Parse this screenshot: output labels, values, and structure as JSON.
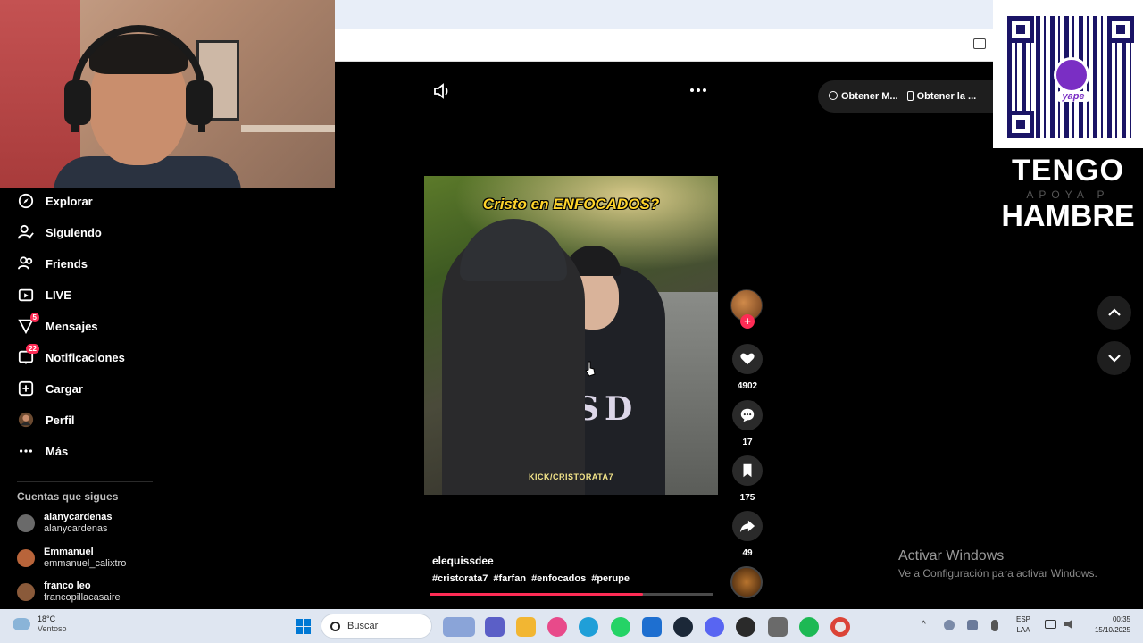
{
  "sidebar": {
    "items": [
      {
        "label": "Explorar",
        "icon": "compass-icon"
      },
      {
        "label": "Siguiendo",
        "icon": "following-icon"
      },
      {
        "label": "Friends",
        "icon": "friends-icon"
      },
      {
        "label": "LIVE",
        "icon": "live-icon"
      },
      {
        "label": "Mensajes",
        "icon": "messages-icon",
        "badge": "5"
      },
      {
        "label": "Notificaciones",
        "icon": "notifications-icon",
        "badge": "22"
      },
      {
        "label": "Cargar",
        "icon": "upload-icon"
      },
      {
        "label": "Perfil",
        "icon": "profile-icon"
      },
      {
        "label": "Más",
        "icon": "more-icon"
      }
    ],
    "following_title": "Cuentas que sigues",
    "accounts": [
      {
        "name": "alanycardenas",
        "handle": "alanycardenas"
      },
      {
        "name": "Emmanuel",
        "handle": "emmanuel_calixtro"
      },
      {
        "name": "franco leo",
        "handle": "francopillacasaire"
      }
    ]
  },
  "top_pill": {
    "btn1": "Obtener M...",
    "btn2": "Obtener la ..."
  },
  "video": {
    "title": "Cristo en ENFOCADOS?",
    "watermark": "KICK/CRISTORATA7",
    "jersey": "SD"
  },
  "caption": {
    "author": "elequissdee",
    "tags": [
      "#cristorata7",
      "#farfan",
      "#enfocados",
      "#perupe"
    ],
    "progress": 0.75
  },
  "actions": {
    "likes": "4902",
    "comments": "17",
    "saves": "175",
    "shares": "49"
  },
  "overlay": {
    "qr_logo": "yape",
    "line1": "TENGO",
    "line2": "APOYA P",
    "line3": "HAMBRE"
  },
  "activate": {
    "title": "Activar Windows",
    "subtitle": "Ve a Configuración para activar Windows."
  },
  "taskbar": {
    "temp": "18°C",
    "weather": "Ventoso",
    "search_placeholder": "Buscar",
    "lang1": "ESP",
    "lang2": "LAA",
    "time": "00:35",
    "date": "15/10/2025"
  },
  "colors": {
    "accent": "#fe2c55",
    "background": "#000000",
    "taskbar": "#dfe6f1"
  }
}
